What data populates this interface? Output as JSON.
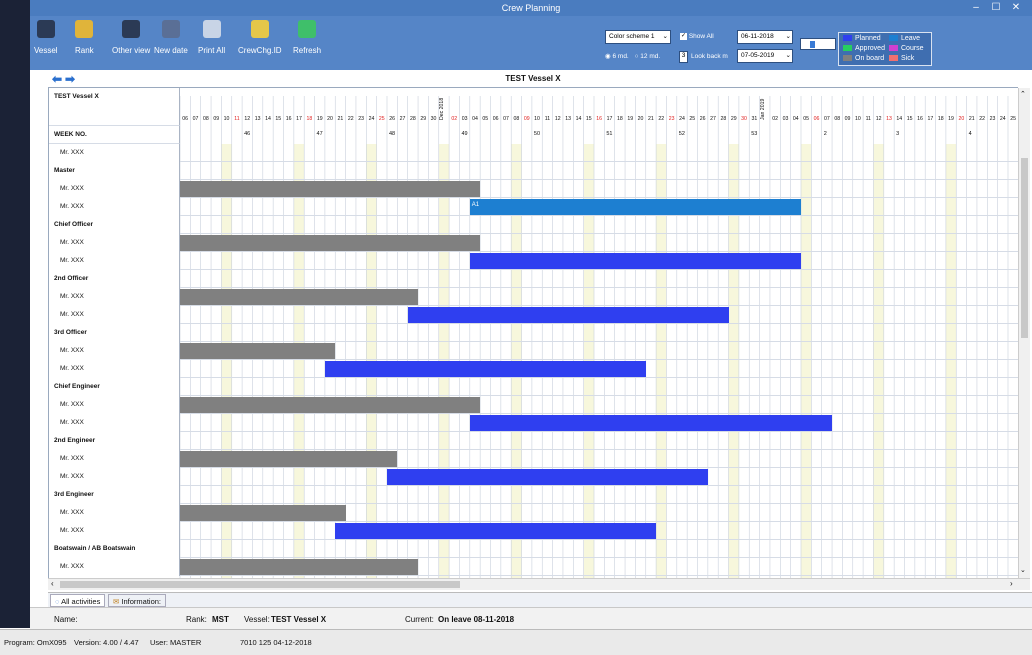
{
  "window": {
    "title": "Crew Planning",
    "minimize": "–",
    "maximize": "☐",
    "close": "✕"
  },
  "toolbar": [
    {
      "label": "Vessel",
      "icon": "vessel-icon",
      "color": "#2b3a55"
    },
    {
      "label": "Rank",
      "icon": "medal-icon",
      "color": "#e0b43a"
    },
    {
      "label": "Other view",
      "icon": "list-icon",
      "color": "#2b3a55"
    },
    {
      "label": "New date",
      "icon": "calendar-icon",
      "color": "#5a6f96"
    },
    {
      "label": "Print All",
      "icon": "print-icon",
      "color": "#c8d4e6"
    },
    {
      "label": "CrewChg.ID",
      "icon": "id-icon",
      "color": "#e5c74a"
    },
    {
      "label": "Refresh",
      "icon": "refresh-icon",
      "color": "#3fbf6a"
    }
  ],
  "controls": {
    "color_scheme": "Color scheme 1",
    "show_all": "Show All",
    "look_back_value": "3",
    "look_back_label": "Look back m",
    "radio_6": "6 md.",
    "radio_12": "12 md.",
    "date_from": "06-11-2018",
    "date_to": "07-05-2019"
  },
  "legend": [
    {
      "label": "Planned",
      "color": "#2f3ff0"
    },
    {
      "label": "Leave",
      "color": "#1d7fd1"
    },
    {
      "label": "Approved",
      "color": "#26d060"
    },
    {
      "label": "Course",
      "color": "#d040d0"
    },
    {
      "label": "On board",
      "color": "#808080"
    },
    {
      "label": "Sick",
      "color": "#f07070"
    }
  ],
  "plan": {
    "vessel_title": "TEST Vessel X",
    "corner_label": "TEST Vessel X",
    "week_label": "WEEK NO.",
    "days": [
      "06",
      "07",
      "08",
      "09",
      "10",
      "11",
      "12",
      "13",
      "14",
      "15",
      "16",
      "17",
      "18",
      "19",
      "20",
      "21",
      "22",
      "23",
      "24",
      "25",
      "26",
      "27",
      "28",
      "29",
      "30",
      "Dec 2018",
      "02",
      "03",
      "04",
      "05",
      "06",
      "07",
      "08",
      "09",
      "10",
      "11",
      "12",
      "13",
      "14",
      "15",
      "16",
      "17",
      "18",
      "19",
      "20",
      "21",
      "22",
      "23",
      "24",
      "25",
      "26",
      "27",
      "28",
      "29",
      "30",
      "31",
      "Jan 2019",
      "02",
      "03",
      "04",
      "05",
      "06",
      "07",
      "08",
      "09",
      "10",
      "11",
      "12",
      "13",
      "14",
      "15",
      "16",
      "17",
      "18",
      "19",
      "20",
      "21",
      "22",
      "23",
      "24",
      "25"
    ],
    "red_days": [
      5,
      12,
      19,
      26,
      33,
      40,
      47,
      54,
      61,
      68,
      75
    ],
    "weeks": [
      {
        "label": "46",
        "at": 6
      },
      {
        "label": "47",
        "at": 13
      },
      {
        "label": "48",
        "at": 20
      },
      {
        "label": "49",
        "at": 27
      },
      {
        "label": "50",
        "at": 34
      },
      {
        "label": "51",
        "at": 41
      },
      {
        "label": "52",
        "at": 48
      },
      {
        "label": "53",
        "at": 55
      },
      {
        "label": "2",
        "at": 62
      },
      {
        "label": "3",
        "at": 69
      },
      {
        "label": "4",
        "at": 76
      }
    ],
    "rows": [
      {
        "label": "Mr. XXX",
        "kind": "name",
        "bars": []
      },
      {
        "label": "Master",
        "kind": "rank",
        "bars": []
      },
      {
        "label": "Mr. XXX",
        "kind": "name",
        "bars": [
          {
            "start": 0,
            "end": 29,
            "status": "On board"
          }
        ]
      },
      {
        "label": "Mr. XXX",
        "kind": "name",
        "bars": [
          {
            "start": 28,
            "end": 60,
            "status": "Leave",
            "text": "A1"
          }
        ]
      },
      {
        "label": "Chief Officer",
        "kind": "rank",
        "bars": []
      },
      {
        "label": "Mr. XXX",
        "kind": "name",
        "bars": [
          {
            "start": 0,
            "end": 29,
            "status": "On board"
          }
        ]
      },
      {
        "label": "Mr. XXX",
        "kind": "name",
        "bars": [
          {
            "start": 28,
            "end": 60,
            "status": "Planned"
          }
        ]
      },
      {
        "label": "2nd Officer",
        "kind": "rank",
        "bars": []
      },
      {
        "label": "Mr. XXX",
        "kind": "name",
        "bars": [
          {
            "start": 0,
            "end": 23,
            "status": "On board"
          }
        ]
      },
      {
        "label": "Mr. XXX",
        "kind": "name",
        "bars": [
          {
            "start": 22,
            "end": 53,
            "status": "Planned"
          }
        ]
      },
      {
        "label": "3rd Officer",
        "kind": "rank",
        "bars": []
      },
      {
        "label": "Mr. XXX",
        "kind": "name",
        "bars": [
          {
            "start": 0,
            "end": 15,
            "status": "On board"
          }
        ]
      },
      {
        "label": "Mr. XXX",
        "kind": "name",
        "bars": [
          {
            "start": 14,
            "end": 45,
            "status": "Planned"
          }
        ]
      },
      {
        "label": "Chief Engineer",
        "kind": "rank",
        "bars": []
      },
      {
        "label": "Mr. XXX",
        "kind": "name",
        "bars": [
          {
            "start": 0,
            "end": 29,
            "status": "On board"
          }
        ]
      },
      {
        "label": "Mr. XXX",
        "kind": "name",
        "bars": [
          {
            "start": 28,
            "end": 63,
            "status": "Planned"
          }
        ]
      },
      {
        "label": "2nd Engineer",
        "kind": "rank",
        "bars": []
      },
      {
        "label": "Mr. XXX",
        "kind": "name",
        "bars": [
          {
            "start": 0,
            "end": 21,
            "status": "On board"
          }
        ]
      },
      {
        "label": "Mr. XXX",
        "kind": "name",
        "bars": [
          {
            "start": 20,
            "end": 51,
            "status": "Planned"
          }
        ]
      },
      {
        "label": "3rd Engineer",
        "kind": "rank",
        "bars": []
      },
      {
        "label": "Mr. XXX",
        "kind": "name",
        "bars": [
          {
            "start": 0,
            "end": 16,
            "status": "On board"
          }
        ]
      },
      {
        "label": "Mr. XXX",
        "kind": "name",
        "bars": [
          {
            "start": 15,
            "end": 46,
            "status": "Planned"
          }
        ]
      },
      {
        "label": "Boatswain / AB Boatswain",
        "kind": "rank",
        "bars": []
      },
      {
        "label": "Mr. XXX",
        "kind": "name",
        "bars": [
          {
            "start": 0,
            "end": 23,
            "status": "On board"
          }
        ]
      }
    ]
  },
  "tabs": {
    "all": "All activities",
    "info": "Information:"
  },
  "info": {
    "name_label": "Name:",
    "rank_label": "Rank:",
    "rank_value": "MST",
    "vessel_label": "Vessel:",
    "vessel_value": "TEST Vessel X",
    "current_label": "Current:",
    "current_value": "On leave  08-11-2018"
  },
  "status": {
    "program": "Program: OmX095",
    "version": "Version: 4.00 / 4.47",
    "user": "User: MASTER",
    "code": "7010  125  04-12-2018"
  }
}
